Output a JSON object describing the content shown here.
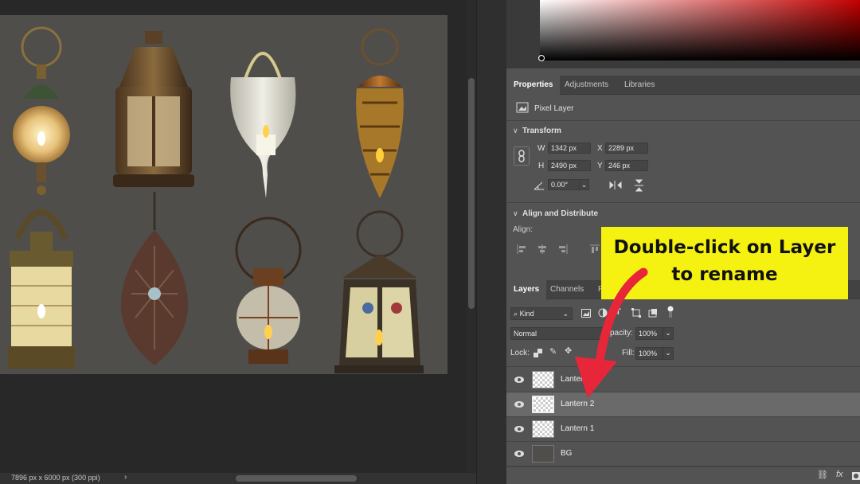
{
  "status": {
    "doc_info": "7896 px x 6000 px (300 ppi)",
    "arrow": "›"
  },
  "properties": {
    "tabs": [
      "Properties",
      "Adjustments",
      "Libraries"
    ],
    "layer_type": "Pixel Layer",
    "transform": {
      "title": "Transform",
      "w_label": "W",
      "w": "1342 px",
      "x_label": "X",
      "x": "2289 px",
      "h_label": "H",
      "h": "2490 px",
      "y_label": "Y",
      "y": "246 px",
      "angle": "0.00°"
    },
    "align": {
      "title": "Align and Distribute",
      "label": "Align:"
    }
  },
  "layers": {
    "tabs": [
      "Layers",
      "Channels",
      "P"
    ],
    "filter_kind": "Kind",
    "blend_mode": "Normal",
    "opacity_label": "pacity:",
    "opacity": "100%",
    "lock_label": "Lock:",
    "fill_label": "Fill:",
    "fill": "100%",
    "items": [
      {
        "name": "Lanter",
        "selected": false
      },
      {
        "name": "Lantern 2",
        "selected": true
      },
      {
        "name": "Lantern 1",
        "selected": false
      },
      {
        "name": "BG",
        "selected": false
      }
    ],
    "footer_fx": "fx"
  },
  "callout": {
    "line1": "Double-click on Layer",
    "line2": "to rename",
    "color": "#f5f110"
  },
  "arrow_color": "#e8263a"
}
